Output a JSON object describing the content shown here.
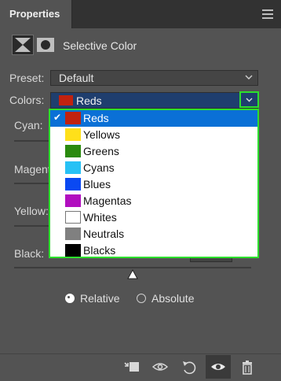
{
  "panel": {
    "tab_label": "Properties"
  },
  "adjustment": {
    "title": "Selective Color"
  },
  "preset": {
    "label": "Preset:",
    "value": "Default"
  },
  "colors": {
    "label": "Colors:",
    "value": "Reds",
    "swatch": "#c1220f",
    "options": [
      {
        "label": "Reds",
        "color": "#c1220f",
        "selected": true
      },
      {
        "label": "Yellows",
        "color": "#ffe01a",
        "selected": false
      },
      {
        "label": "Greens",
        "color": "#2a8a0e",
        "selected": false
      },
      {
        "label": "Cyans",
        "color": "#27c1f5",
        "selected": false
      },
      {
        "label": "Blues",
        "color": "#0a49f2",
        "selected": false
      },
      {
        "label": "Magentas",
        "color": "#b10fbf",
        "selected": false
      },
      {
        "label": "Whites",
        "color": "#ffffff",
        "selected": false
      },
      {
        "label": "Neutrals",
        "color": "#808080",
        "selected": false
      },
      {
        "label": "Blacks",
        "color": "#000000",
        "selected": false
      }
    ]
  },
  "sliders": {
    "cyan": {
      "label": "Cyan:"
    },
    "magenta": {
      "label": "Magent"
    },
    "yellow": {
      "label": "Yellow:"
    },
    "black": {
      "label": "Black:"
    }
  },
  "method": {
    "relative": {
      "label": "Relative",
      "checked": true
    },
    "absolute": {
      "label": "Absolute",
      "checked": false
    }
  },
  "footer": {
    "icons": [
      "clip-to-layer-icon",
      "view-previous-state-icon",
      "reset-icon",
      "toggle-visibility-icon",
      "delete-icon"
    ]
  },
  "colors_accent": {
    "highlight": "#0a70d6",
    "focus_outline": "#2ce02c"
  }
}
